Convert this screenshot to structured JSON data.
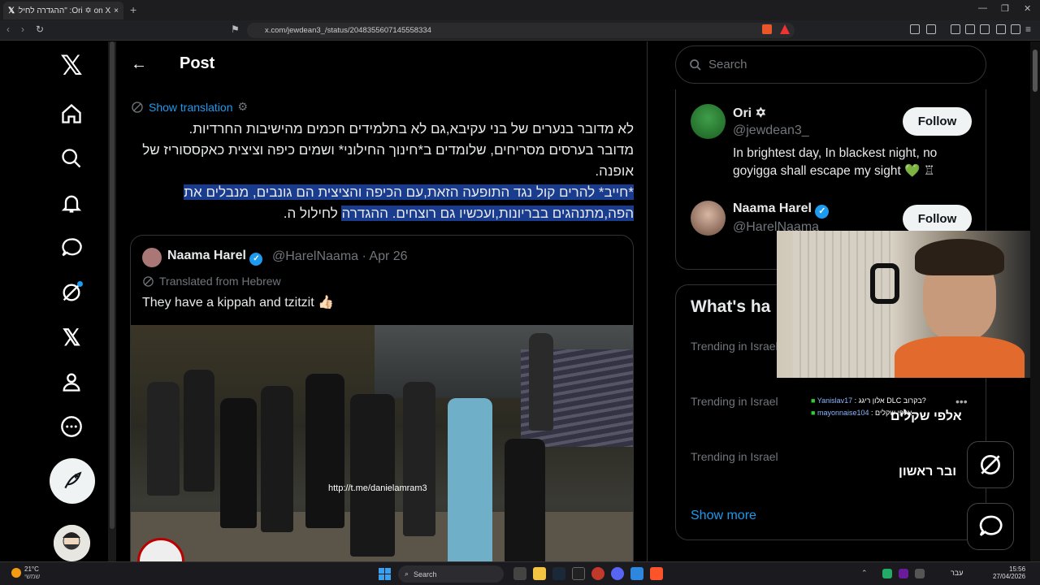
{
  "browser": {
    "tab_title": "Ori ✡ on X: \"ההגדרה לחילול ה'\"...",
    "tab_close": "×",
    "new_tab": "+",
    "url": "x.com/jewdean3_/status/2048355607145558334"
  },
  "header": {
    "title": "Post",
    "back_icon": "arrow-left-icon"
  },
  "post": {
    "show_translation": "Show translation",
    "line1": "לא מדובר בנערים של בני עקיבא,גם לא בתלמידים חכמים מהישיבות החרדיות.",
    "line2": "מדובר בערסים מסריחים, שלומדים ב*חינוך החילוני* ושמים כיפה וציצית כאקססוריז של אופנה.",
    "line3a": "*חייב* להרים קול נגד התופעה הזאת,עם הכיפה והציצית הם גונבים, מנבלים את הפה,מתנהגים בבריונות,ועכשיו גם רוצחים. ההגדרה",
    "line3b": " לחילול ה."
  },
  "quote": {
    "name": "Naama Harel",
    "handle_date": "@HarelNaama · Apr 26",
    "translated": "Translated from Hebrew",
    "text": "They have a kippah and tzitzit 👍🏻",
    "watermark": "http://t.me/danielamram3"
  },
  "search": {
    "placeholder": "Search"
  },
  "who_to_follow": [
    {
      "name": "Ori ✡",
      "handle": "@jewdean3_",
      "button": "Follow",
      "bio": "In brightest day, In blackest night, no goyigga shall escape my sight 💚 ♖"
    },
    {
      "name": "Naama Harel",
      "handle": "@HarelNaama",
      "button": "Follow"
    }
  ],
  "trends": {
    "title": "What's ha",
    "items": [
      "Trending in Israel",
      "Trending in Israel",
      "Trending in Israel"
    ],
    "show_more": "Show more"
  },
  "overlay": {
    "chat": [
      {
        "user": "Yanislav17",
        "msg": ": אלון ריגג DLC בקרוב?"
      },
      {
        "user": "mayonnaise104",
        "msg": ": אלפי שקלים"
      }
    ],
    "big_text": "אלפי שקלים",
    "big_text2": "ובר ראשון"
  },
  "taskbar": {
    "temp": "21°C",
    "weather": "שמשי",
    "search": "Search",
    "lang": "עבר",
    "time": "15:56",
    "date": "27/04/2026"
  },
  "colors": {
    "accent": "#1d9bf0",
    "verified": "#1d9bf0",
    "selection": "#1a3c8f"
  }
}
